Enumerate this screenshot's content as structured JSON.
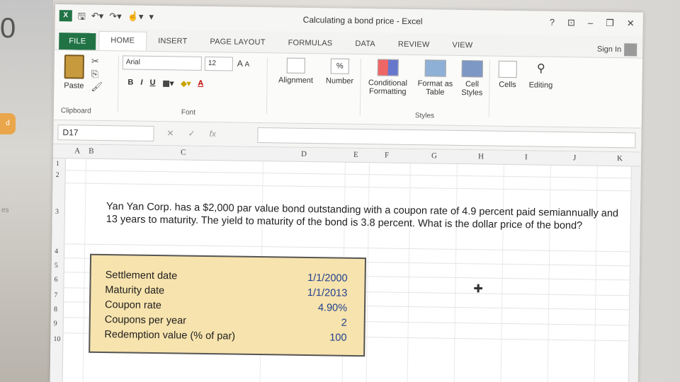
{
  "background": {
    "left_digit": "0",
    "tab_label": "d",
    "side_text": "es"
  },
  "window": {
    "title": "Calculating a bond price - Excel",
    "controls": [
      "?",
      "⊡",
      "–",
      "❐",
      "✕"
    ]
  },
  "tabs": [
    {
      "label": "FILE"
    },
    {
      "label": "HOME"
    },
    {
      "label": "INSERT"
    },
    {
      "label": "PAGE LAYOUT"
    },
    {
      "label": "FORMULAS"
    },
    {
      "label": "DATA"
    },
    {
      "label": "REVIEW"
    },
    {
      "label": "VIEW"
    }
  ],
  "signin": "Sign In",
  "ribbon": {
    "paste_label": "Paste",
    "clipboard_label": "Clipboard",
    "font_name": "Arial",
    "font_size": "12",
    "grow": "A",
    "shrink": "A",
    "bold": "B",
    "italic": "I",
    "underline": "U",
    "font_color_letter": "A",
    "font_label": "Font",
    "alignment": "Alignment",
    "number": "Number",
    "number_symbol": "%",
    "conditional": "Conditional",
    "conditional2": "Formatting",
    "format_as": "Format as",
    "format_as2": "Table",
    "cell": "Cell",
    "cell2": "Styles",
    "styles_label": "Styles",
    "cells": "Cells",
    "editing": "Editing"
  },
  "formula_bar": {
    "name_box": "D17",
    "cancel": "✕",
    "enter": "✓",
    "fx": "fx"
  },
  "columns": [
    "A",
    "B",
    "C",
    "D",
    "E",
    "F",
    "G",
    "H",
    "I",
    "J",
    "K"
  ],
  "rows": [
    "1",
    "2",
    "3",
    "4",
    "5",
    "6",
    "7",
    "8",
    "9",
    "10"
  ],
  "question": "Yan Yan Corp. has a $2,000 par value bond outstanding with a coupon rate of 4.9 percent paid semiannually and 13 years to maturity. The yield to maturity of the bond is 3.8 percent. What is the dollar price of the bond?",
  "table": [
    {
      "label": "Settlement date",
      "value": "1/1/2000"
    },
    {
      "label": "Maturity date",
      "value": "1/1/2013"
    },
    {
      "label": "Coupon rate",
      "value": "4.90%"
    },
    {
      "label": "Coupons per year",
      "value": "2"
    },
    {
      "label": "Redemption value (% of par)",
      "value": "100"
    }
  ]
}
